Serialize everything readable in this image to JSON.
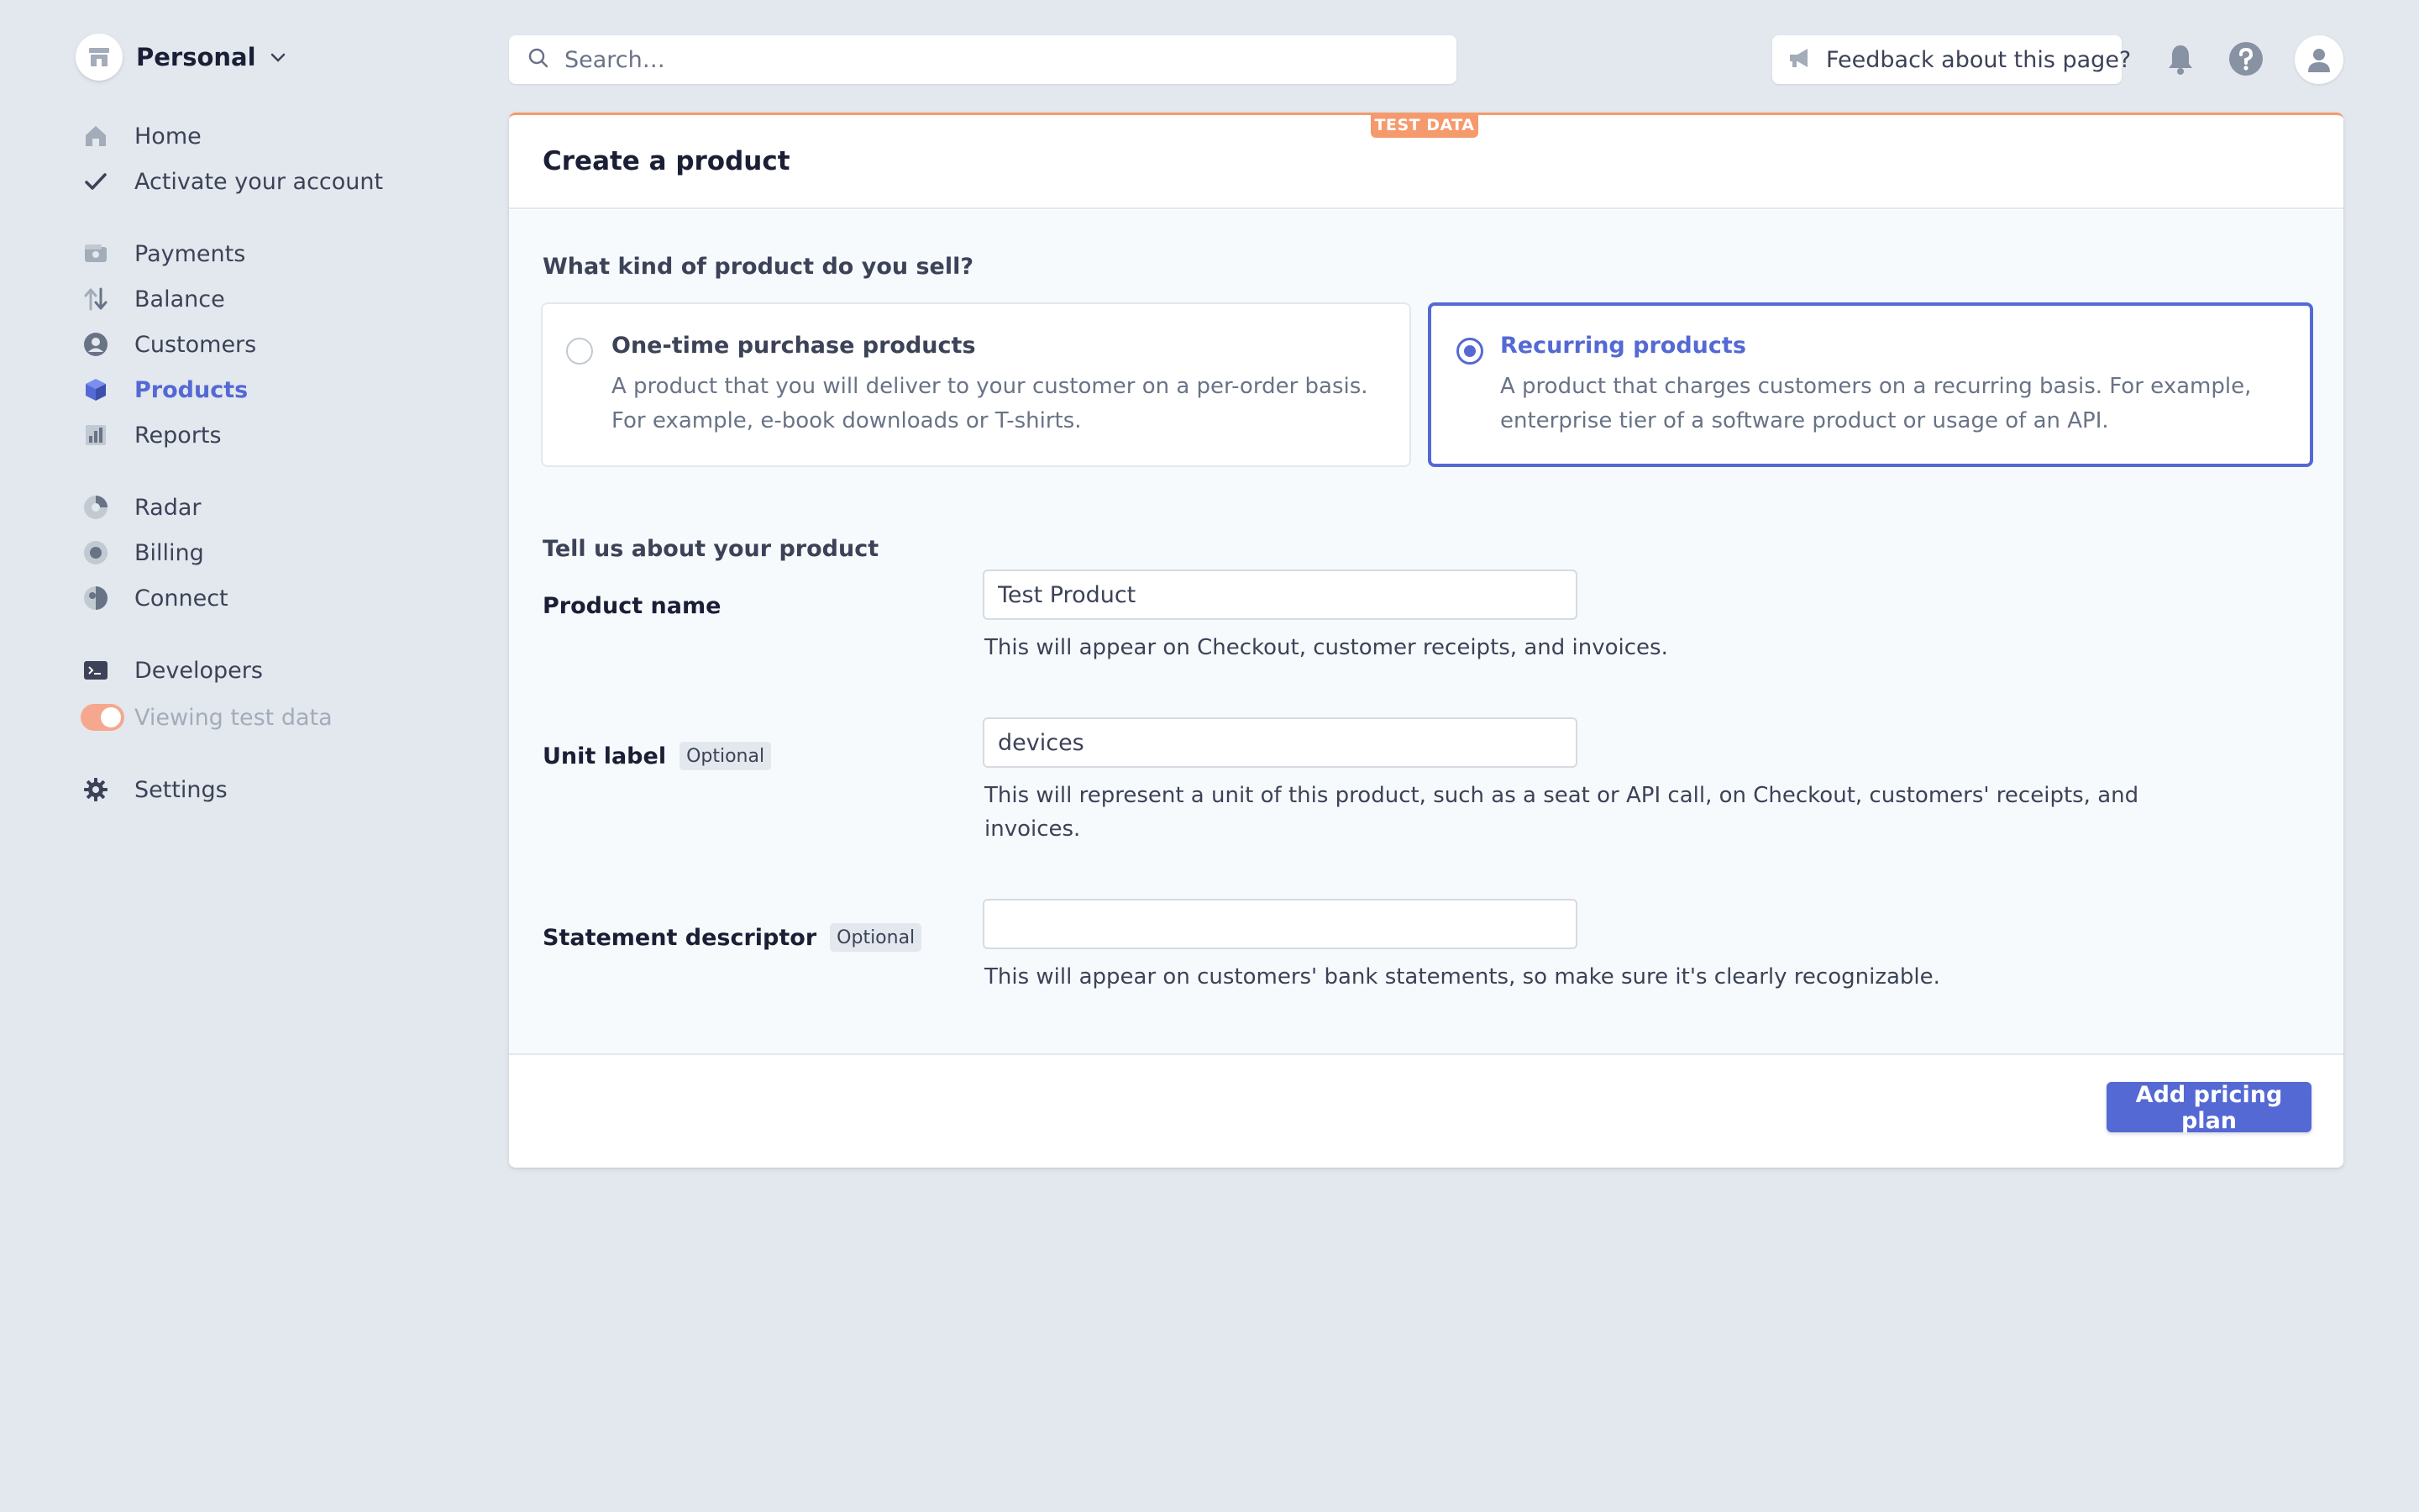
{
  "account": {
    "name": "Personal"
  },
  "sidebar": {
    "items": [
      {
        "label": "Home"
      },
      {
        "label": "Activate your account"
      },
      {
        "label": "Payments"
      },
      {
        "label": "Balance"
      },
      {
        "label": "Customers"
      },
      {
        "label": "Products",
        "active": true
      },
      {
        "label": "Reports"
      },
      {
        "label": "Radar"
      },
      {
        "label": "Billing"
      },
      {
        "label": "Connect"
      },
      {
        "label": "Developers"
      },
      {
        "label": "Viewing test data",
        "toggle": "on"
      },
      {
        "label": "Settings"
      }
    ]
  },
  "header": {
    "search_placeholder": "Search…",
    "feedback_label": "Feedback about this page?"
  },
  "card": {
    "badge": "TEST DATA",
    "title": "Create a product",
    "question": "What kind of product do you sell?",
    "options": [
      {
        "title": "One-time purchase products",
        "description": "A product that you will deliver to your customer on a per-order basis. For example, e-book downloads or T-shirts.",
        "selected": false
      },
      {
        "title": "Recurring products",
        "description": "A product that charges customers on a recurring basis. For example, enterprise tier of a software product or usage of an API.",
        "selected": true
      }
    ],
    "section_title": "Tell us about your product",
    "fields": {
      "product_name": {
        "label": "Product name",
        "value": "Test Product",
        "help": "This will appear on Checkout, customer receipts, and invoices."
      },
      "unit_label": {
        "label": "Unit label",
        "tag": "Optional",
        "value": "devices",
        "help": "This will represent a unit of this product, such as a seat or API call, on Checkout, customers' receipts, and invoices."
      },
      "statement_descriptor": {
        "label": "Statement descriptor",
        "tag": "Optional",
        "value": "",
        "help": "This will appear on customers' bank statements, so make sure it's clearly recognizable."
      }
    },
    "footer_button": "Add pricing plan"
  },
  "colors": {
    "accent": "#5469d4",
    "test_badge": "#f59a6d",
    "background": "#e3e8ee",
    "text": "#1a1f36",
    "muted_text": "#697386"
  },
  "icons": {
    "account": "store-icon",
    "account_menu": "chevron-down-icon",
    "search": "search-icon",
    "feedback": "megaphone-icon",
    "notifications": "bell-icon",
    "help": "question-circle-icon",
    "profile": "user-avatar-icon"
  }
}
